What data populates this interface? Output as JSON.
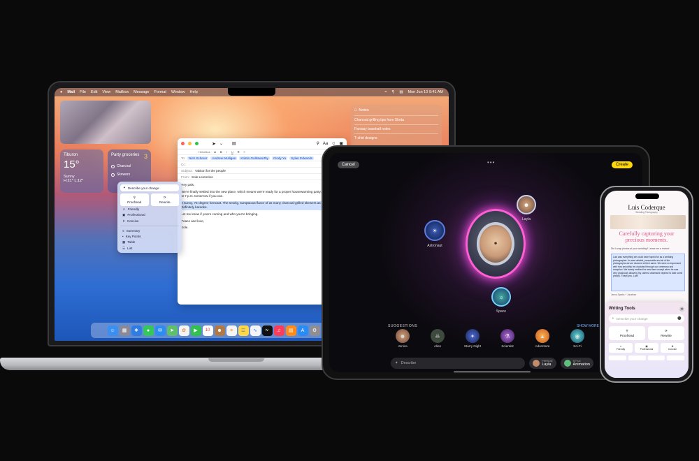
{
  "mac": {
    "menubar": {
      "apple": "",
      "items": [
        "Mail",
        "File",
        "Edit",
        "View",
        "Mailbox",
        "Message",
        "Format",
        "Window",
        "Help"
      ],
      "datetime": "Mon Jun 10  9:41 AM"
    },
    "weather": {
      "city": "Tiburon",
      "temp": "15°",
      "condition": "Sunny",
      "range": "H:21° L:12°"
    },
    "groceries": {
      "title": "Party groceries",
      "count": "3",
      "items": [
        "Charcoal",
        "Skewers"
      ]
    },
    "notes": {
      "title": "Notes",
      "items": [
        "Charcoal grilling tips from Shota",
        "Fantasy baseball notes",
        "T-shirt designs"
      ]
    },
    "mail": {
      "font": "Helvetica",
      "to_label": "To:",
      "recipients": [
        "Nick Scherer",
        "Andrew Mulligan",
        "Kristin Goldsworthy",
        "Cindy Yu",
        "Sylan Edwards"
      ],
      "cc_label": "Cc:",
      "subject_label": "Subject:",
      "subject": "Yakitori for the people",
      "from_label": "From:",
      "from": "Sole Lorenzino",
      "greeting": "Hey pals,",
      "p1": "We're finally settled into the new place, which means we're ready for a proper housewarming party. Please join us at 7 p.m. tomorrow if you can.",
      "p2": "A sunny, 74-degree forecast. The smoky, sumptuous flavor of as many charcoal-grilled skewers as you can eat. Definitely karaoke.",
      "p3": "Let me know if you're coming and who you're bringing.",
      "signoff": "Peace and love,",
      "signature": "Sole."
    },
    "writing_tools": {
      "describe": "Describe your change",
      "proofread": "Proofread",
      "rewrite": "Rewrite",
      "tones": [
        "Friendly",
        "Professional",
        "Concise"
      ],
      "formats": [
        "Summary",
        "Key Points",
        "Table",
        "List"
      ]
    },
    "dock_apps": [
      "finder-icon",
      "launchpad-icon",
      "safari-icon",
      "messages-icon",
      "mail-icon",
      "maps-icon",
      "photos-icon",
      "facetime-icon",
      "calendar-icon",
      "contacts-icon",
      "reminders-icon",
      "notes-icon",
      "freeform-icon",
      "tv-icon",
      "music-icon",
      "books-icon",
      "appstore-icon",
      "settings-icon",
      "trash-icon"
    ],
    "calendar_day": "10",
    "tv_label": "tv"
  },
  "ipad": {
    "cancel": "Cancel",
    "create": "Create",
    "astronaut": "Astronaut",
    "person": "Layla",
    "space": "Space",
    "suggestions_title": "SUGGESTIONS",
    "show_more": "SHOW MORE",
    "suggestions": [
      "Jonica",
      "Alien",
      "Starry Night",
      "Scientist",
      "Adventure",
      "Sci-Fi"
    ],
    "describe_placeholder": "Describe",
    "person_pill": {
      "sub": "PERSON",
      "value": "Layla"
    },
    "style_pill": {
      "sub": "STYLE",
      "value": "Animation"
    }
  },
  "iphone": {
    "site_title": "Luis Coderque",
    "site_sub": "Wedding Photography",
    "headline": "Carefully capturing your precious moments.",
    "question": "Did I snap photos at your wedding? Leave me a review!",
    "review": "Luis was everything we could have hoped for as a wedding photographer. he was reliable, personable and all of the photographs we are stunned at their same. We were so impressed with how smoothly he circulated through our ceremony and reception. We barely realized he was there except when he was very graciously allowing my camera obsessed nephew to take some photos. Thank you, Luis!",
    "name": "Jenna Sparks + Jonathan",
    "tools_title": "Writing Tools",
    "describe": "Describe your change",
    "proofread": "Proofread",
    "rewrite": "Rewrite",
    "tones": [
      "Friendly",
      "Professional",
      "Concise"
    ]
  }
}
